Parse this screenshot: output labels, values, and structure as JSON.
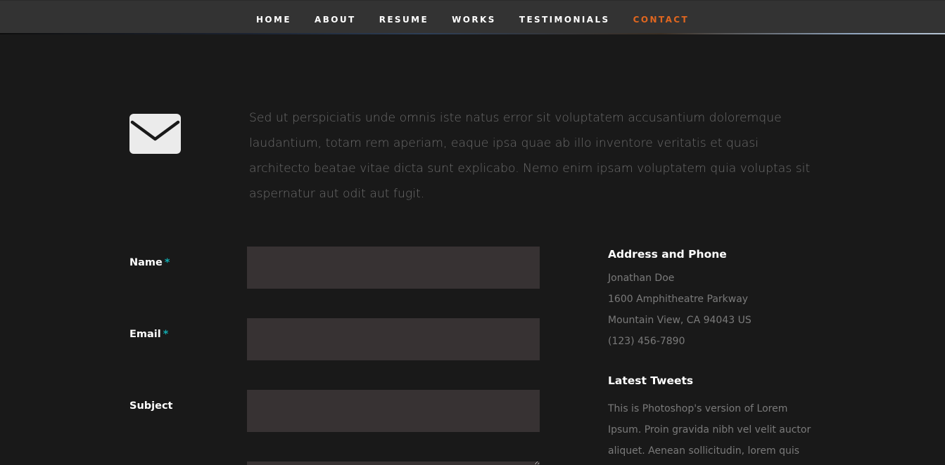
{
  "nav": {
    "items": [
      "HOME",
      "ABOUT",
      "RESUME",
      "WORKS",
      "TESTIMONIALS",
      "CONTACT"
    ],
    "active": "CONTACT",
    "active_color": "#e0661f"
  },
  "contact": {
    "icon": "envelope-icon",
    "lead": "Sed ut perspiciatis unde omnis iste natus error sit voluptatem accusantium doloremque laudantium, totam rem aperiam, eaque ipsa quae ab illo inventore veritatis et quasi architecto beatae vitae dicta sunt explicabo. Nemo enim ipsam voluptatem quia voluptas sit aspernatur aut odit aut fugit."
  },
  "form": {
    "name_label": "Name",
    "email_label": "Email",
    "subject_label": "Subject",
    "required_mark": "*",
    "required_color": "#11abb0",
    "name_value": "",
    "email_value": "",
    "subject_value": ""
  },
  "sidebar": {
    "address_heading": "Address and Phone",
    "address_lines": [
      "Jonathan Doe",
      "1600 Amphitheatre Parkway",
      "Mountain View, CA 94043 US",
      "(123) 456-7890"
    ],
    "tweets_heading": "Latest Tweets",
    "tweet_lines": [
      "This is Photoshop's version of Lorem",
      "Ipsum. Proin gravida nibh vel velit auctor",
      "aliquet. Aenean sollicitudin, lorem quis"
    ]
  }
}
